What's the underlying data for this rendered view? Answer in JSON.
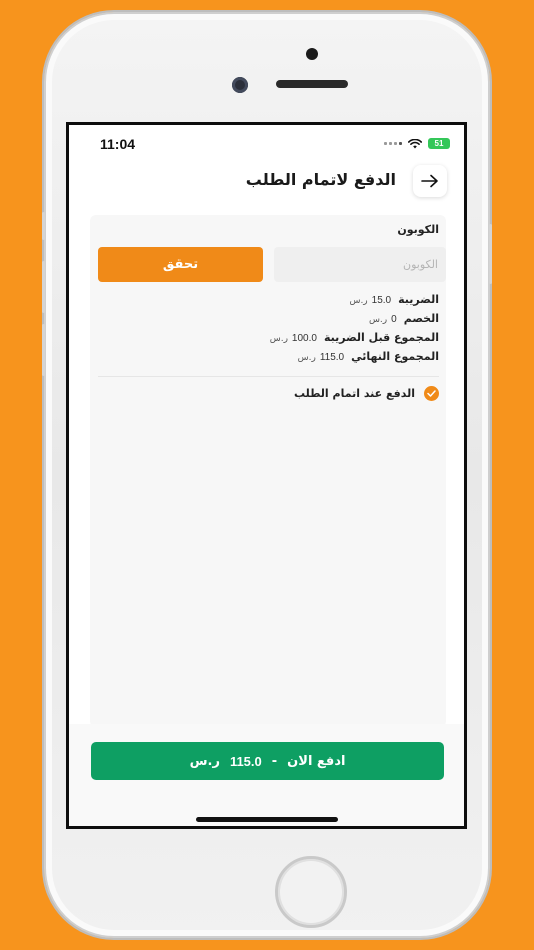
{
  "status_bar": {
    "time": "11:04",
    "battery": "51"
  },
  "header": {
    "title": "الدفع لاتمام الطلب",
    "back_icon": "arrow-right-icon"
  },
  "coupon": {
    "title": "الكوبون",
    "placeholder": "الكوبون",
    "value": "",
    "button_label": "تحقق"
  },
  "summary": {
    "currency": "ر.س",
    "rows": [
      {
        "label": "الضريبة",
        "value": "15.0"
      },
      {
        "label": "الخصم",
        "value": "0"
      },
      {
        "label": "المجموع قبل الضريبة",
        "value": "100.0"
      },
      {
        "label": "المجموع النهائي",
        "value": "115.0"
      }
    ]
  },
  "payment_option": {
    "label": "الدفع عند اتمام الطلب",
    "checked": true
  },
  "pay_button": {
    "label": "ادفع الان",
    "separator": "-",
    "amount": "115.0",
    "currency": "ر.س"
  },
  "colors": {
    "background": "#F7941D",
    "accent": "#F08A18",
    "pay": "#0E9F63"
  }
}
